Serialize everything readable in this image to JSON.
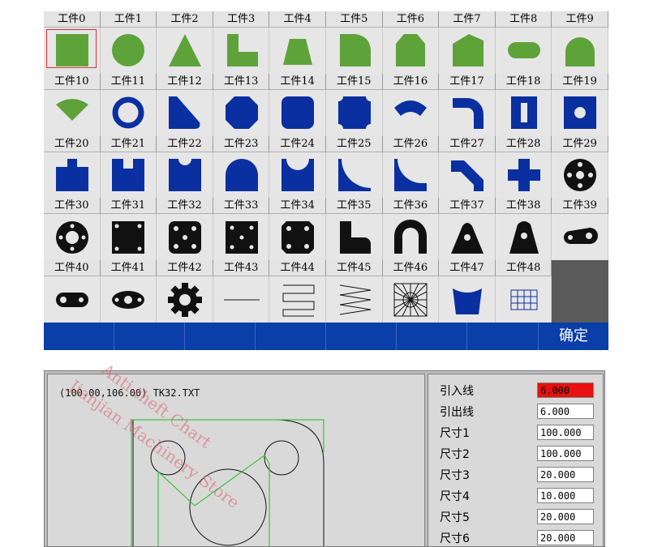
{
  "library": {
    "items": [
      {
        "label": "工件0",
        "icon": "square-icon",
        "color": "green"
      },
      {
        "label": "工件1",
        "icon": "circle-icon",
        "color": "green"
      },
      {
        "label": "工件2",
        "icon": "triangle-icon",
        "color": "green"
      },
      {
        "label": "工件3",
        "icon": "l-shape-icon",
        "color": "green"
      },
      {
        "label": "工件4",
        "icon": "trapezoid-icon",
        "color": "green"
      },
      {
        "label": "工件5",
        "icon": "rounded-corner-square-icon",
        "color": "green"
      },
      {
        "label": "工件6",
        "icon": "pentagon-house-icon",
        "color": "green"
      },
      {
        "label": "工件7",
        "icon": "slanted-roof-icon",
        "color": "green"
      },
      {
        "label": "工件8",
        "icon": "slot-icon",
        "color": "green"
      },
      {
        "label": "工件9",
        "icon": "d-shape-icon",
        "color": "green"
      },
      {
        "label": "工件10",
        "icon": "fan-sector-icon",
        "color": "green"
      },
      {
        "label": "工件11",
        "icon": "ring-icon",
        "color": "blue"
      },
      {
        "label": "工件12",
        "icon": "ramp-icon",
        "color": "blue"
      },
      {
        "label": "工件13",
        "icon": "octagon-icon",
        "color": "blue"
      },
      {
        "label": "工件14",
        "icon": "rounded-square-icon",
        "color": "blue"
      },
      {
        "label": "工件15",
        "icon": "notched-square-icon",
        "color": "blue"
      },
      {
        "label": "工件16",
        "icon": "arc-band-icon",
        "color": "blue"
      },
      {
        "label": "工件17",
        "icon": "elbow-icon",
        "color": "blue"
      },
      {
        "label": "工件18",
        "icon": "square-with-slot-icon",
        "color": "blue"
      },
      {
        "label": "工件19",
        "icon": "square-with-hole-icon",
        "color": "blue"
      },
      {
        "label": "工件20",
        "icon": "stepped-block-icon",
        "color": "blue"
      },
      {
        "label": "工件21",
        "icon": "notch-top-icon",
        "color": "blue"
      },
      {
        "label": "工件22",
        "icon": "round-notch-top-icon",
        "color": "blue"
      },
      {
        "label": "工件23",
        "icon": "arch-icon",
        "color": "blue"
      },
      {
        "label": "工件24",
        "icon": "concave-top-icon",
        "color": "blue"
      },
      {
        "label": "工件25",
        "icon": "concave-corner-icon",
        "color": "blue"
      },
      {
        "label": "工件26",
        "icon": "quarter-cutout-icon",
        "color": "blue"
      },
      {
        "label": "工件27",
        "icon": "bent-strip-icon",
        "color": "blue"
      },
      {
        "label": "工件28",
        "icon": "cross-icon",
        "color": "blue"
      },
      {
        "label": "工件29",
        "icon": "flange-icon",
        "color": "black"
      },
      {
        "label": "工件30",
        "icon": "ring-flange-icon",
        "color": "black"
      },
      {
        "label": "工件31",
        "icon": "plate-4-holes-icon",
        "color": "black"
      },
      {
        "label": "工件32",
        "icon": "plate-5-holes-icon",
        "color": "black"
      },
      {
        "label": "工件33",
        "icon": "plate-5-holes-alt-icon",
        "color": "black"
      },
      {
        "label": "工件34",
        "icon": "notched-plate-icon",
        "color": "black"
      },
      {
        "label": "工件35",
        "icon": "l-bracket-icon",
        "color": "black"
      },
      {
        "label": "工件36",
        "icon": "u-bracket-icon",
        "color": "black"
      },
      {
        "label": "工件37",
        "icon": "lug-icon",
        "color": "black"
      },
      {
        "label": "工件38",
        "icon": "tall-lug-icon",
        "color": "black"
      },
      {
        "label": "工件39",
        "icon": "link-icon",
        "color": "black"
      },
      {
        "label": "工件40",
        "icon": "link-small-icon",
        "color": "black"
      },
      {
        "label": "工件41",
        "icon": "double-flange-icon",
        "color": "black"
      },
      {
        "label": "工件42",
        "icon": "gear-icon",
        "color": "black"
      },
      {
        "label": "工件43",
        "icon": "line-icon",
        "color": "black"
      },
      {
        "label": "工件44",
        "icon": "zigzag-icon",
        "color": "black"
      },
      {
        "label": "工件45",
        "icon": "wave-icon",
        "color": "black"
      },
      {
        "label": "工件46",
        "icon": "mesh-square-icon",
        "color": "black"
      },
      {
        "label": "工件47",
        "icon": "cup-icon",
        "color": "blue"
      },
      {
        "label": "工件48",
        "icon": "grid-icon",
        "color": "blue"
      }
    ],
    "selected_index": 0,
    "colors": {
      "green": "#5ea33a",
      "blue": "#0a2fa0",
      "black": "#111111"
    },
    "ok_label": "确定"
  },
  "preview": {
    "coord_text": "(100.00,106.00) TK32.TXT"
  },
  "params": [
    {
      "label": "引入线",
      "value": "6.000",
      "active": true
    },
    {
      "label": "引出线",
      "value": "6.000",
      "active": false
    },
    {
      "label": "尺寸1",
      "value": "100.000",
      "active": false
    },
    {
      "label": "尺寸2",
      "value": "100.000",
      "active": false
    },
    {
      "label": "尺寸3",
      "value": "20.000",
      "active": false
    },
    {
      "label": "尺寸4",
      "value": "10.000",
      "active": false
    },
    {
      "label": "尺寸5",
      "value": "20.000",
      "active": false
    },
    {
      "label": "尺寸6",
      "value": "20.000",
      "active": false
    }
  ],
  "watermark": {
    "line1": "Anti-theft Chart",
    "line2": "Jianjian Machinery Store"
  }
}
